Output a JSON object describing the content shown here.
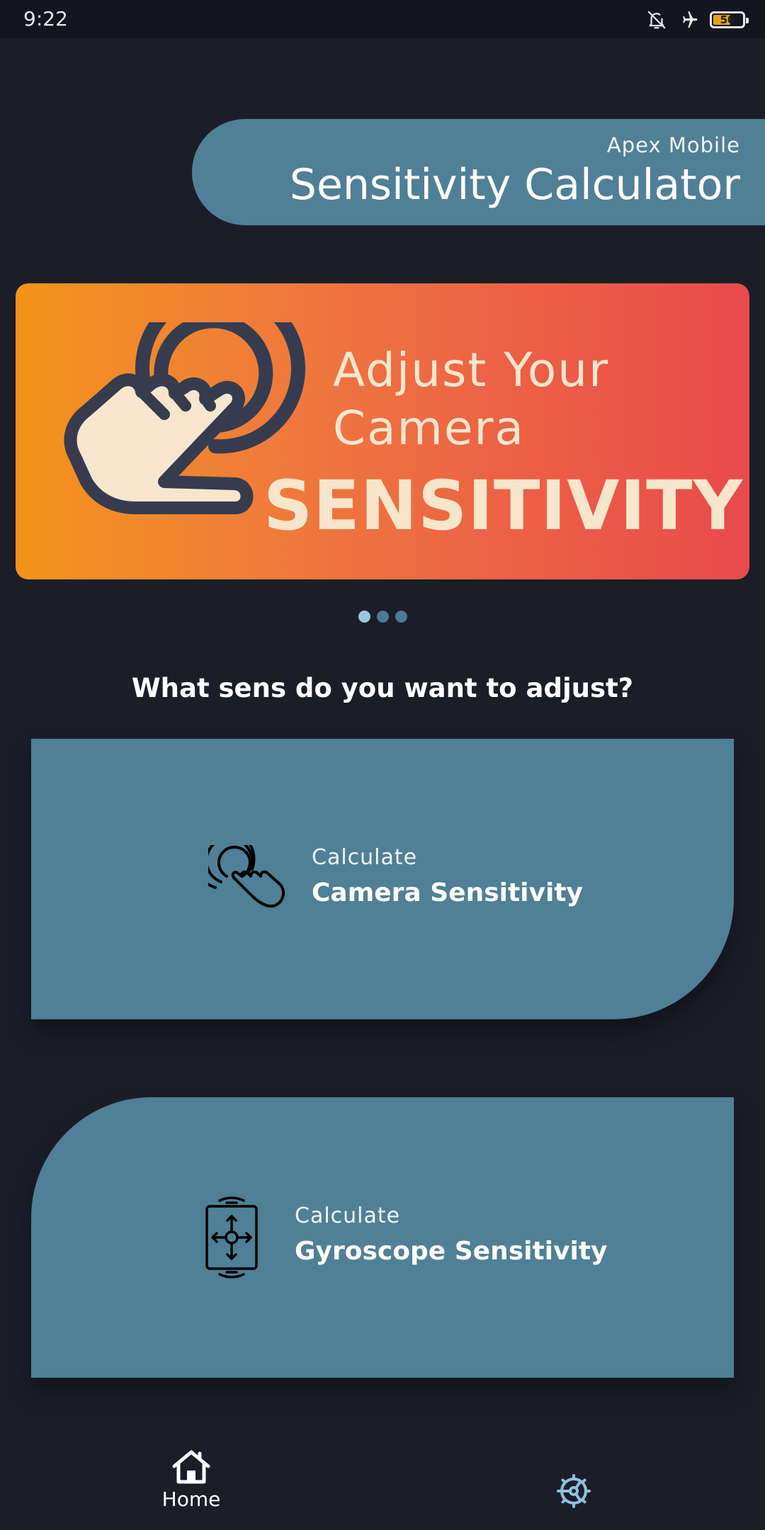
{
  "status_bar": {
    "time": "9:22",
    "battery_level": "50",
    "icons": [
      "bell-off-icon",
      "airplane-icon",
      "battery-icon"
    ]
  },
  "header": {
    "subtitle": "Apex Mobile",
    "title": "Sensitivity Calculator"
  },
  "banner": {
    "line1": "Adjust Your",
    "line2": "Camera",
    "big": "SENSITIVITY",
    "icon": "touch-hand-icon",
    "slide_count": 3,
    "active_slide": 1
  },
  "question": "What sens do you want to adjust?",
  "options": [
    {
      "small": "Calculate",
      "big": "Camera Sensitivity",
      "icon": "touch-gesture-icon"
    },
    {
      "small": "Calculate",
      "big": "Gyroscope Sensitivity",
      "icon": "gyroscope-phone-icon"
    }
  ],
  "bottom_nav": {
    "home_label": "Home",
    "home_icon": "home-icon",
    "settings_icon": "settings-gear-icon"
  },
  "colors": {
    "background": "#1b1e29",
    "accent": "#4f8097",
    "banner_start": "#f39419",
    "banner_end": "#e84a4c",
    "banner_text": "#f7e6cc",
    "dot_active": "#9bc8dd",
    "settings_icon": "#8ec2de"
  }
}
